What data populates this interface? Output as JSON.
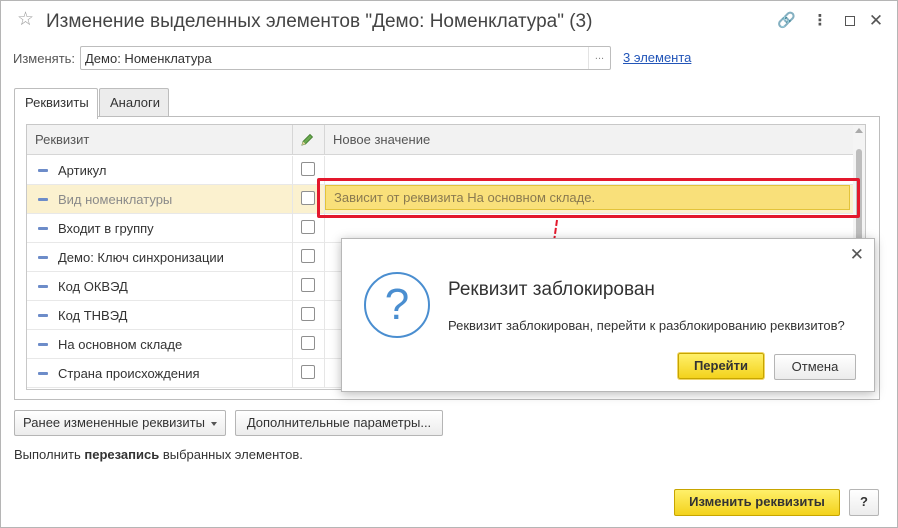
{
  "window": {
    "title": "Изменение выделенных элементов \"Демо: Номенклатура\" (3)"
  },
  "change_row": {
    "label": "Изменять:",
    "value": "Демо: Номенклатура",
    "dots": "...",
    "count_link": "3 элемента"
  },
  "tabs": [
    {
      "label": "Реквизиты",
      "active": true
    },
    {
      "label": "Аналоги",
      "active": false
    }
  ],
  "table": {
    "columns": [
      "Реквизит",
      "",
      "Новое значение"
    ],
    "rows": [
      {
        "name": "Артикул",
        "checked": false
      },
      {
        "name": "Вид номенклатуры",
        "checked": false,
        "selected": true,
        "value": "Зависит от реквизита На основном складе."
      },
      {
        "name": "Входит в группу",
        "checked": false
      },
      {
        "name": "Демо: Ключ синхронизации",
        "checked": false
      },
      {
        "name": "Код ОКВЭД",
        "checked": false
      },
      {
        "name": "Код ТНВЭД",
        "checked": false
      },
      {
        "name": "На основном складе",
        "checked": false
      },
      {
        "name": "Страна происхождения",
        "checked": false
      }
    ]
  },
  "dialog": {
    "icon": "?",
    "title": "Реквизит заблокирован",
    "message": "Реквизит заблокирован, перейти к разблокированию реквизитов?",
    "go_label": "Перейти",
    "cancel_label": "Отмена"
  },
  "bottom": {
    "prev_label": "Ранее измененные реквизиты",
    "more_label": "Дополнительные параметры...",
    "run_prefix": "Выполнить ",
    "run_bold": "перезапись",
    "run_suffix": " выбранных элементов.",
    "change_label": "Изменить реквизиты",
    "help_label": "?"
  },
  "colors": {
    "accent_yellow": "#f3d21c",
    "highlight_red": "#e3182d",
    "link_blue": "#2255b8",
    "icon_blue": "#4a8ed0",
    "selected_row": "#fbf1cf"
  }
}
